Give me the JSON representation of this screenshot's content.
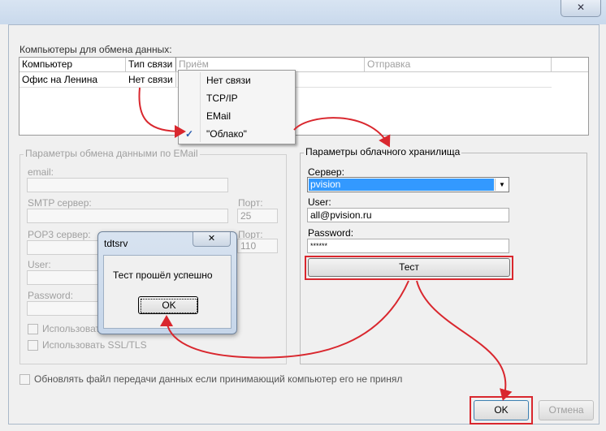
{
  "window": {
    "close_glyph": "✕"
  },
  "computers": {
    "section_label": "Компьютеры для обмена данных:",
    "columns": [
      "Компьютер",
      "Тип связи",
      "Приём",
      "Отправка"
    ],
    "rows": [
      {
        "computer": "Офис на Ленина",
        "link_type": "Нет связи"
      }
    ]
  },
  "link_menu": {
    "items": [
      {
        "label": "Нет связи",
        "checked": false
      },
      {
        "label": "TCP/IP",
        "checked": false
      },
      {
        "label": "EMail",
        "checked": false
      },
      {
        "label": "\"Облако\"",
        "checked": true
      }
    ],
    "check_glyph": "✓"
  },
  "email_params": {
    "title": "Параметры обмена данными по EMail",
    "email_label": "email:",
    "smtp_label": "SMTP сервер:",
    "smtp_port_label": "Порт:",
    "smtp_port": "25",
    "pop3_label": "POP3 сервер:",
    "pop3_port_label": "Порт:",
    "pop3_port": "110",
    "user_label": "User:",
    "password_label": "Password:",
    "use_ssl_1": "Использовать",
    "use_ssl_2": "Использовать SSL/TLS"
  },
  "cloud_params": {
    "title": "Параметры облачного хранилища",
    "server_label": "Сервер:",
    "server_value": "pvision",
    "user_label": "User:",
    "user_value": "all@pvision.ru",
    "password_label": "Password:",
    "password_value": "******",
    "test_button": "Тест"
  },
  "resend_option": "Обновлять файл передачи данных если принимающий компьютер его не принял",
  "buttons": {
    "ok": "OK",
    "cancel": "Отмена"
  },
  "message_box": {
    "title": "tdtsrv",
    "text": "Тест прошёл успешно",
    "ok": "OK",
    "close_glyph": "✕"
  },
  "colors": {
    "accent_red": "#d9272e",
    "selection_blue": "#3399ff"
  }
}
